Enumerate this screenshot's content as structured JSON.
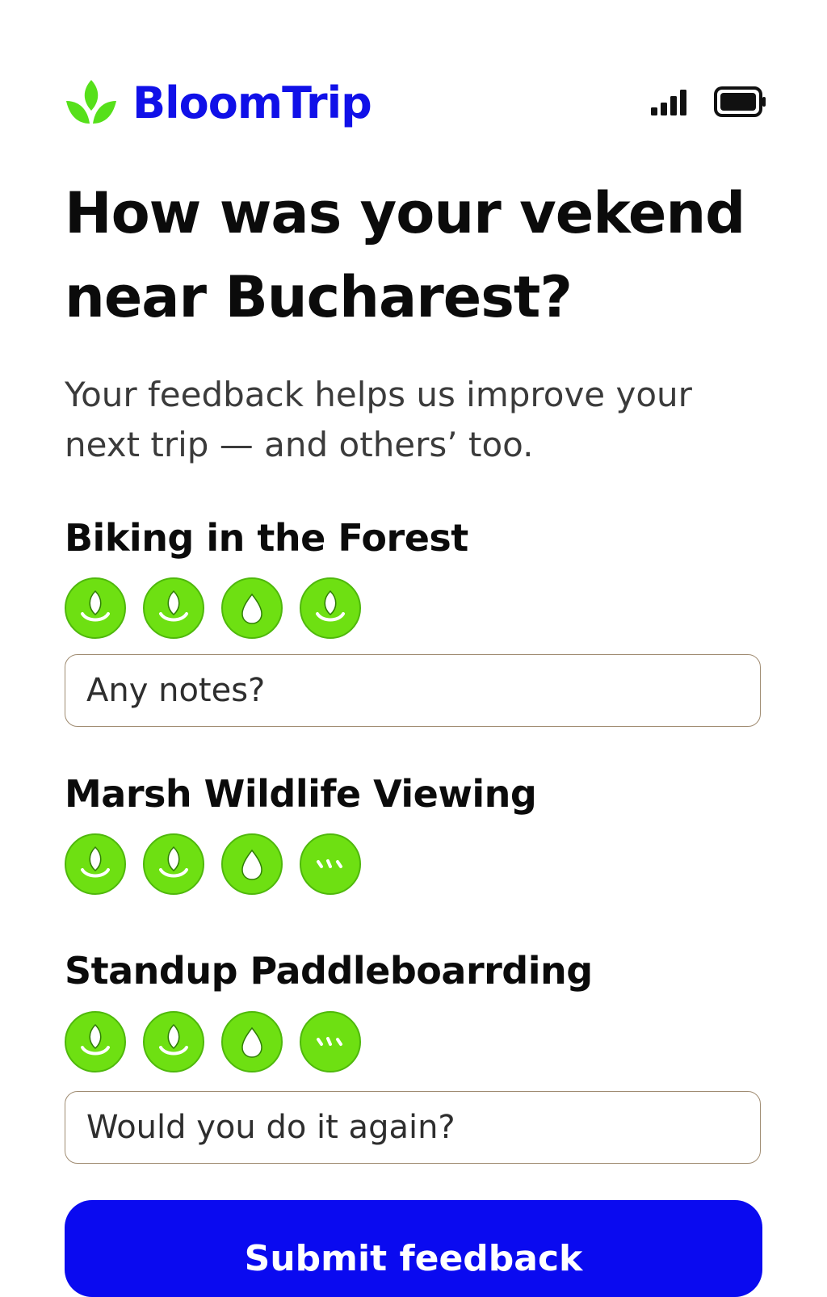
{
  "app": {
    "brand_name": "BloomTrip",
    "brand_color": "#1010e8",
    "accent_color": "#6ee012",
    "logo_icon": "leaf-sprout-icon"
  },
  "status_bar": {
    "signal_icon": "signal-bars-icon",
    "battery_icon": "battery-full-icon"
  },
  "page": {
    "title": "How was your vekend near Bucharest?",
    "subtitle": "Your feedback helps us improve your next trip — and others’ too."
  },
  "activities": [
    {
      "name": "Biking in the Forest",
      "rating_icons": [
        "sprout-icon",
        "sprout-icon",
        "drop-icon",
        "sprout-icon"
      ],
      "note_placeholder": "Any notes?"
    },
    {
      "name": "Marsh Wildlife Viewing",
      "rating_icons": [
        "sprout-icon",
        "sprout-icon",
        "drop-icon",
        "dots-icon"
      ]
    },
    {
      "name": "Standup Paddleboarrding",
      "rating_icons": [
        "sprout-icon",
        "sprout-icon",
        "drop-icon",
        "dots-icon"
      ],
      "note_placeholder": "Would you do it again?"
    }
  ],
  "submit": {
    "label": "Submit feedback",
    "color": "#0a0af0"
  }
}
